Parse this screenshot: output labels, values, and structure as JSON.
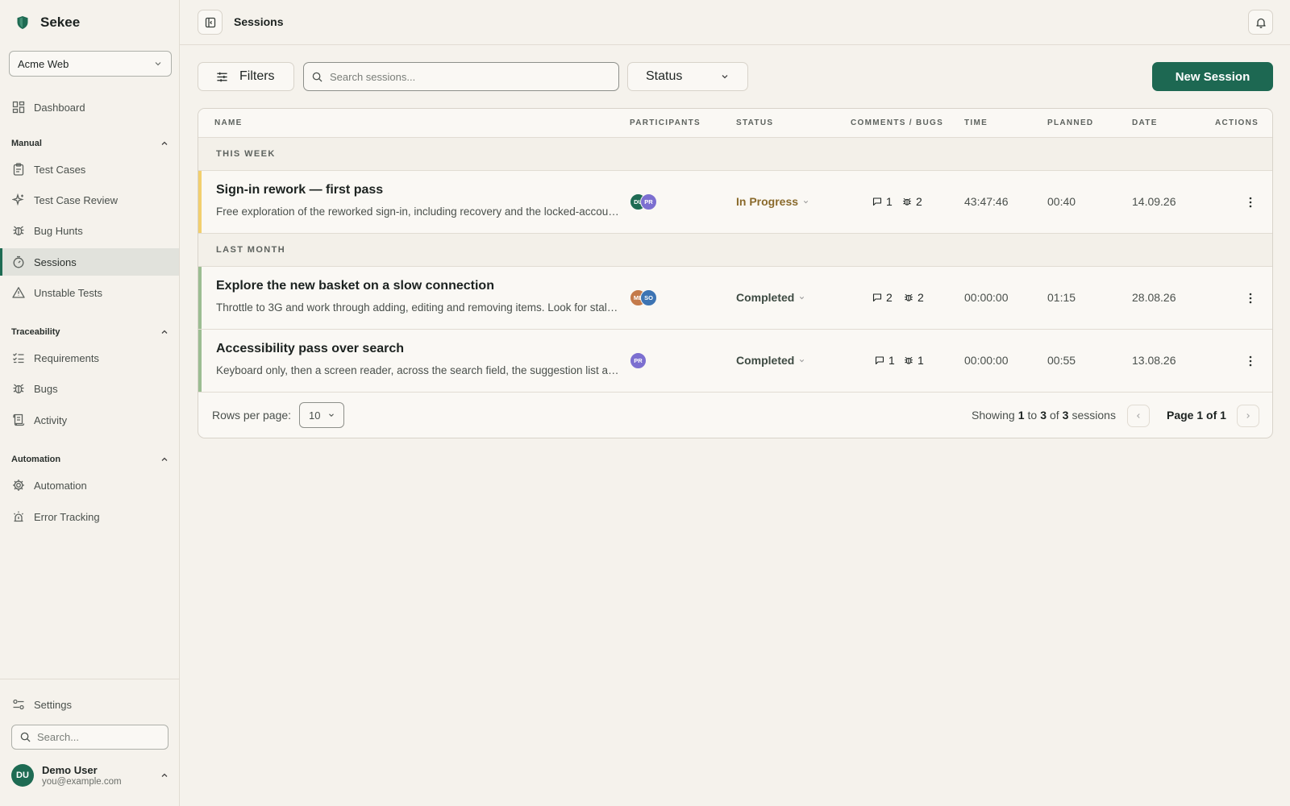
{
  "app": {
    "name": "Sekee",
    "project": "Acme Web"
  },
  "sidebar": {
    "dashboard": "Dashboard",
    "sections": {
      "manual": "Manual",
      "traceability": "Traceability",
      "automation": "Automation"
    },
    "items": {
      "test_cases": "Test Cases",
      "test_case_review": "Test Case Review",
      "bug_hunts": "Bug Hunts",
      "sessions": "Sessions",
      "unstable_tests": "Unstable Tests",
      "requirements": "Requirements",
      "bugs": "Bugs",
      "activity": "Activity",
      "automation": "Automation",
      "error_tracking": "Error Tracking"
    },
    "settings": "Settings",
    "search_placeholder": "Search...",
    "user": {
      "initials": "DU",
      "name": "Demo User",
      "email": "you@example.com"
    }
  },
  "header": {
    "title": "Sessions"
  },
  "toolbar": {
    "filters_label": "Filters",
    "search_placeholder": "Search sessions...",
    "status_label": "Status",
    "new_session_label": "New Session"
  },
  "table": {
    "columns": {
      "name": "NAME",
      "participants": "PARTICIPANTS",
      "status": "STATUS",
      "comments_bugs": "COMMENTS / BUGS",
      "time": "TIME",
      "planned": "PLANNED",
      "date": "DATE",
      "actions": "ACTIONS"
    },
    "groups": {
      "this_week": "THIS WEEK",
      "last_month": "LAST MONTH"
    },
    "rows": [
      {
        "name": "Sign-in rework — first pass",
        "description": "Free exploration of the reworked sign-in, including recovery and the locked-account flow.",
        "participants": [
          {
            "initials": "DU",
            "color": "#1e6b53"
          },
          {
            "initials": "PR",
            "color": "#7c6fd0"
          }
        ],
        "status": "In Progress",
        "status_color": "#8a6a2c",
        "bar_color": "#f2cf6e",
        "comments": "1",
        "bugs": "2",
        "time": "43:47:46",
        "planned": "00:40",
        "date": "14.09.26"
      },
      {
        "name": "Explore the new basket on a slow connection",
        "description": "Throttle to 3G and work through adding, editing and removing items. Look for stale totals.",
        "participants": [
          {
            "initials": "ME",
            "color": "#c47a4a"
          },
          {
            "initials": "SO",
            "color": "#3d74b3"
          }
        ],
        "status": "Completed",
        "status_color": "#3d4a42",
        "bar_color": "#9cbd92",
        "comments": "2",
        "bugs": "2",
        "time": "00:00:00",
        "planned": "01:15",
        "date": "28.08.26"
      },
      {
        "name": "Accessibility pass over search",
        "description": "Keyboard only, then a screen reader, across the search field, the suggestion list and results.",
        "participants": [
          {
            "initials": "PR",
            "color": "#7c6fd0"
          }
        ],
        "status": "Completed",
        "status_color": "#3d4a42",
        "bar_color": "#9cbd92",
        "comments": "1",
        "bugs": "1",
        "time": "00:00:00",
        "planned": "00:55",
        "date": "13.08.26"
      }
    ]
  },
  "pagination": {
    "rows_per_page_label": "Rows per page:",
    "rows_per_page": "10",
    "showing_prefix": "Showing",
    "from": "1",
    "to_word": "to",
    "to": "3",
    "of_word": "of",
    "total": "3",
    "suffix": "sessions",
    "page_label": "Page 1 of 1"
  },
  "colors": {
    "accent": "#1d6852",
    "background": "#f5f2ec"
  }
}
